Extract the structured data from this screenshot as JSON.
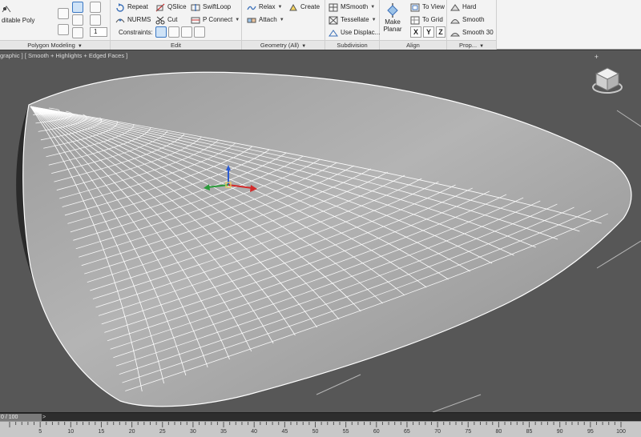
{
  "ribbon": {
    "modeling": {
      "editable_poly_label": "ditable Poly",
      "panel_label": "Polygon Modeling",
      "spinner_value": "1"
    },
    "edit": {
      "repeat": "Repeat",
      "qslice": "QSlice",
      "swiftloop": "SwiftLoop",
      "nurms": "NURMS",
      "cut": "Cut",
      "pconnect": "P Connect",
      "constraints": "Constraints:",
      "panel_label": "Edit"
    },
    "geometry": {
      "relax": "Relax",
      "create": "Create",
      "attach": "Attach",
      "panel_label": "Geometry (All)"
    },
    "subdivision": {
      "msmooth": "MSmooth",
      "tessellate": "Tessellate",
      "use_displace": "Use Displac...",
      "panel_label": "Subdivision"
    },
    "align": {
      "make_planar_line1": "Make",
      "make_planar_line2": "Planar",
      "to_view": "To View",
      "to_grid": "To Grid",
      "x": "X",
      "y": "Y",
      "z": "Z",
      "panel_label": "Align"
    },
    "properties": {
      "hard": "Hard",
      "smooth": "Smooth",
      "smooth30": "Smooth 30",
      "panel_label": "Prop..."
    }
  },
  "viewport": {
    "label": "graphic ] [ Smooth + Highlights + Edged Faces ]",
    "plus": "+"
  },
  "timeline": {
    "slider_text": "0 / 100",
    "arrow": ">",
    "ticks": [
      "5",
      "10",
      "15",
      "20",
      "25",
      "30",
      "35",
      "40",
      "45",
      "50",
      "55",
      "60",
      "65",
      "70",
      "75",
      "80",
      "85",
      "90",
      "95",
      "100"
    ]
  },
  "colors": {
    "ribbon_bg": "#f3f3f3",
    "viewport_bg": "#575757",
    "mesh_fill": "#a9a9a9",
    "mesh_edge": "#ffffff",
    "gizmo_x": "#d22a2a",
    "gizmo_y": "#2a9a3a",
    "gizmo_z": "#2a5ad2"
  }
}
